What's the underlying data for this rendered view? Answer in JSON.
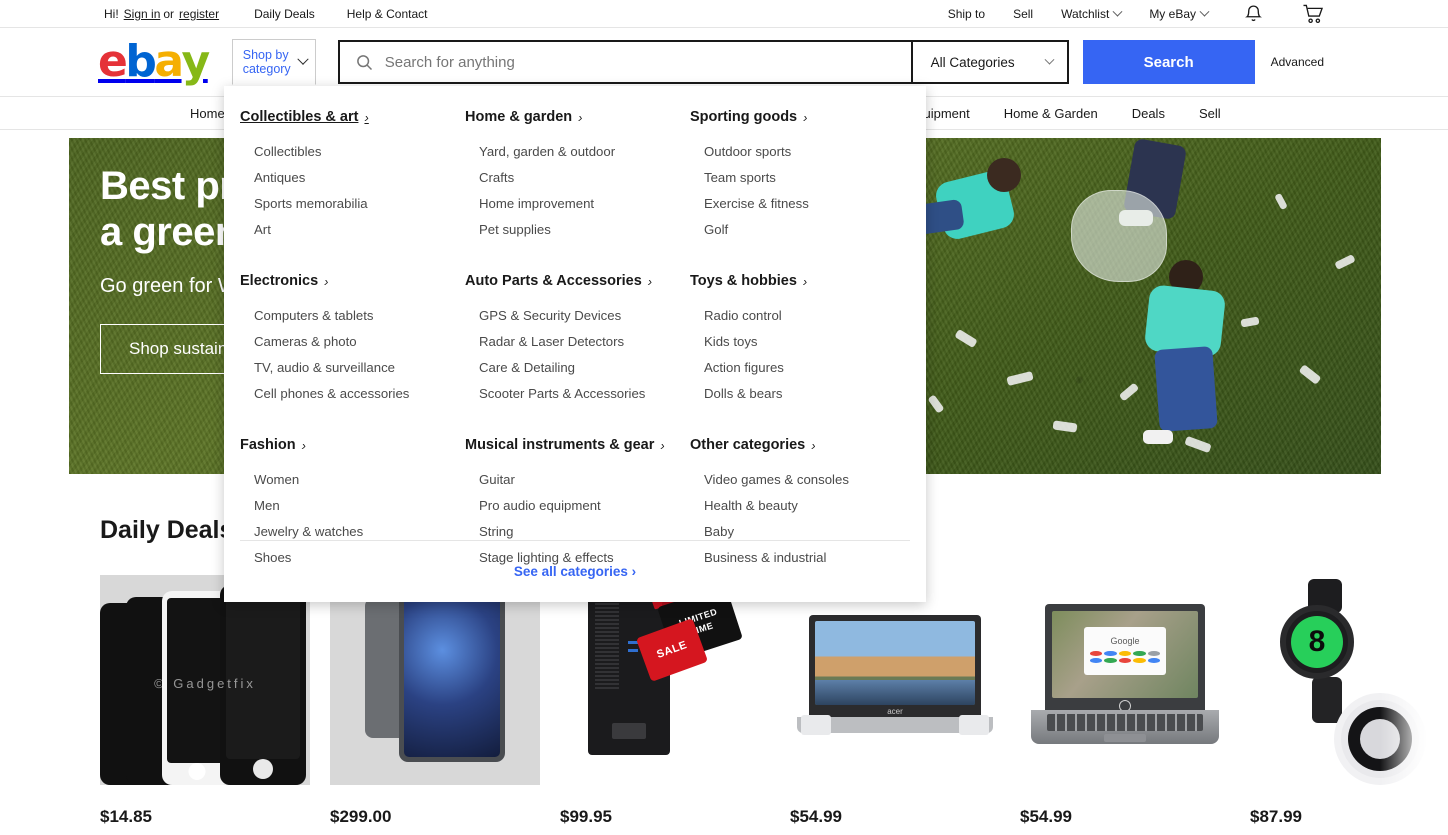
{
  "topbar": {
    "greeting": "Hi!",
    "signin": "Sign in",
    "or": "or",
    "register": "register",
    "links": [
      {
        "label": "Daily Deals"
      },
      {
        "label": "Help & Contact"
      }
    ],
    "right_links": [
      {
        "label": "Ship to",
        "caret": false
      },
      {
        "label": "Sell",
        "caret": false
      },
      {
        "label": "Watchlist",
        "caret": true
      },
      {
        "label": "My eBay",
        "caret": true
      }
    ],
    "notifications_icon": "bell-icon",
    "cart_icon": "cart-icon"
  },
  "header": {
    "logo_letters": [
      "e",
      "b",
      "a",
      "y"
    ],
    "logo_colors": {
      "e": "#e53238",
      "b": "#0064d2",
      "a": "#f5af02",
      "y": "#86b817"
    },
    "shop_by_category": "Shop by category",
    "search": {
      "placeholder": "Search for anything",
      "value": "",
      "icon": "search-icon"
    },
    "category_select": {
      "selected": "All Categories",
      "options": [
        "All Categories"
      ]
    },
    "search_button": "Search",
    "search_button_color": "#3665f3",
    "advanced": "Advanced"
  },
  "catnav": {
    "items": [
      {
        "label": "Home"
      },
      {
        "label": "Industrial equipment"
      },
      {
        "label": "Home & Garden"
      },
      {
        "label": "Deals"
      },
      {
        "label": "Sell"
      }
    ]
  },
  "mega_menu": {
    "columns": [
      {
        "title": "Collectibles & art",
        "hovered": true,
        "links": [
          "Collectibles",
          "Antiques",
          "Sports memorabilia",
          "Art"
        ]
      },
      {
        "title": "Home & garden",
        "hovered": false,
        "links": [
          "Yard, garden & outdoor",
          "Crafts",
          "Home improvement",
          "Pet supplies"
        ]
      },
      {
        "title": "Sporting goods",
        "hovered": false,
        "links": [
          "Outdoor sports",
          "Team sports",
          "Exercise & fitness",
          "Golf"
        ]
      },
      {
        "title": "Electronics",
        "hovered": false,
        "links": [
          "Computers & tablets",
          "Cameras & photo",
          "TV, audio & surveillance",
          "Cell phones & accessories"
        ]
      },
      {
        "title": "Auto Parts & Accessories",
        "hovered": false,
        "links": [
          "GPS & Security Devices",
          "Radar & Laser Detectors",
          "Care & Detailing",
          "Scooter Parts & Accessories"
        ]
      },
      {
        "title": "Toys & hobbies",
        "hovered": false,
        "links": [
          "Radio control",
          "Kids toys",
          "Action figures",
          "Dolls & bears"
        ]
      },
      {
        "title": "Fashion",
        "hovered": false,
        "links": [
          "Women",
          "Men",
          "Jewelry & watches",
          "Shoes"
        ]
      },
      {
        "title": "Musical instruments & gear",
        "hovered": false,
        "links": [
          "Guitar",
          "Pro audio equipment",
          "String",
          "Stage lighting & effects"
        ]
      },
      {
        "title": "Other categories",
        "hovered": false,
        "links": [
          "Video games & consoles",
          "Health & beauty",
          "Baby",
          "Business & industrial"
        ]
      }
    ],
    "see_all": "See all categories",
    "see_all_color": "#3665f3"
  },
  "hero": {
    "title_line1": "Best pr",
    "title_line2": "a green",
    "subtitle": "Go green for W",
    "button": "Shop sustaina",
    "background_color": "#4e6620"
  },
  "deals": {
    "heading": "Daily Deals",
    "items": [
      {
        "price": "$14.85",
        "art": "phone-screens",
        "watermark": "© Gadgetfix"
      },
      {
        "price": "$299.00",
        "art": "tablet"
      },
      {
        "price": "$99.95",
        "art": "desktop-tower",
        "tag1": "LIMITED",
        "tag2": "TIME",
        "tag3": "SALE"
      },
      {
        "price": "$54.99",
        "art": "laptop-acer",
        "brand": "acer"
      },
      {
        "price": "$54.99",
        "art": "laptop-hp",
        "screen_text": "Google"
      },
      {
        "price": "$87.99",
        "art": "smartwatch"
      }
    ]
  }
}
